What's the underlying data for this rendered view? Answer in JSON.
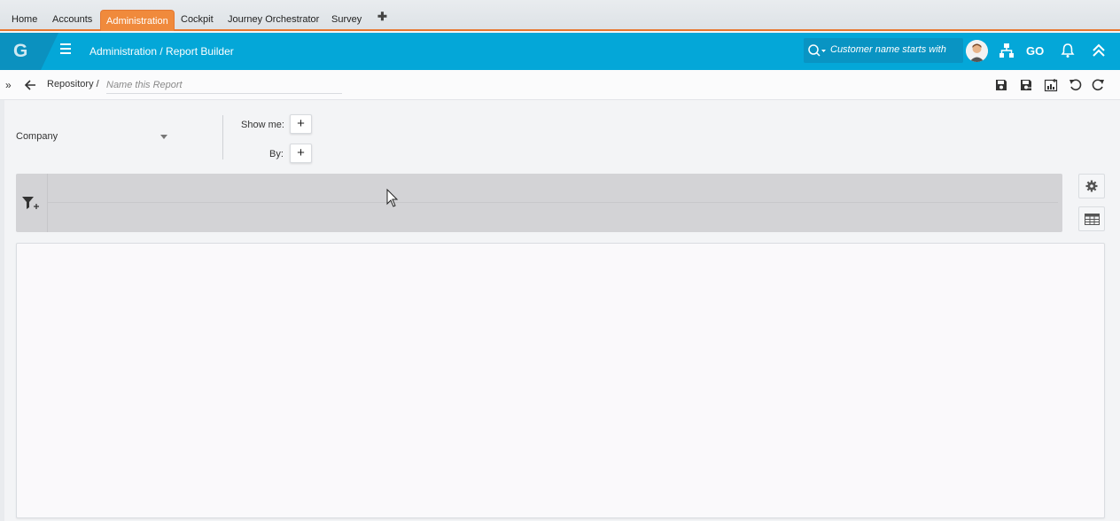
{
  "tabs": [
    {
      "label": "Home",
      "active": false
    },
    {
      "label": "Accounts",
      "active": false
    },
    {
      "label": "Administration",
      "active": true
    },
    {
      "label": "Cockpit",
      "active": false
    },
    {
      "label": "Journey Orchestrator",
      "active": false
    },
    {
      "label": "Survey",
      "active": false
    }
  ],
  "header": {
    "logo": "G",
    "breadcrumb": "Administration / Report Builder",
    "search_placeholder": "Customer name starts with",
    "go_label": "GO"
  },
  "toolbar": {
    "repository": "Repository /",
    "name_placeholder": "Name this Report"
  },
  "config": {
    "object": "Company",
    "show_me_label": "Show me:",
    "by_label": "By:",
    "add_symbol": "+"
  },
  "colors": {
    "accent_orange": "#f08a3c",
    "header_blue": "#04a7d8",
    "filter_bar": "#d3d3d6"
  },
  "icons": [
    "search-icon",
    "avatar",
    "hierarchy-icon",
    "go-icon",
    "bell-icon",
    "collapse-up-icon",
    "save-icon",
    "save-as-icon",
    "add-chart-icon",
    "undo-icon",
    "redo-icon",
    "filter-add-icon",
    "gear-icon",
    "table-view-icon"
  ]
}
